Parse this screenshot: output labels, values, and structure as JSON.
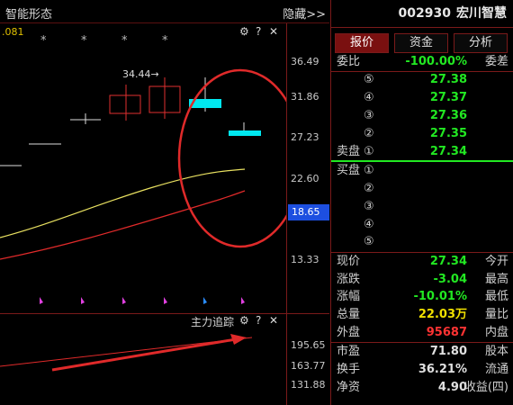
{
  "chart_panel": {
    "title": "智能形态",
    "hide_label": "隐藏>>",
    "top_tag": ".081",
    "tools": {
      "gear": "⚙",
      "help": "?",
      "close": "✕"
    },
    "price_labels": [
      "36.49",
      "31.86",
      "27.23",
      "22.60",
      "13.33"
    ],
    "current_price_label": "18.65",
    "callout": "34.44→",
    "star_glyph": "*"
  },
  "sub_panel": {
    "title": "主力追踪",
    "tools": {
      "gear": "⚙",
      "help": "?",
      "close": "✕"
    },
    "axis_labels": [
      "195.65",
      "163.77",
      "131.88"
    ]
  },
  "quote_panel": {
    "code": "002930",
    "name": "宏川智慧",
    "tabs": [
      "报价",
      "资金",
      "分析"
    ],
    "weibi_label": "委比",
    "weibi_value": "-100.00%",
    "weicha_label": "委差",
    "sell_label": "卖盘",
    "buy_label": "买盘",
    "sell_levels": [
      {
        "n": "⑤",
        "price": "27.38"
      },
      {
        "n": "④",
        "price": "27.37"
      },
      {
        "n": "③",
        "price": "27.36"
      },
      {
        "n": "②",
        "price": "27.35"
      },
      {
        "n": "①",
        "price": "27.34"
      }
    ],
    "buy_levels": [
      "①",
      "②",
      "③",
      "④",
      "⑤"
    ],
    "stats": [
      {
        "l": "现价",
        "v": "27.34",
        "r": "今开",
        "color": "green"
      },
      {
        "l": "涨跌",
        "v": "-3.04",
        "r": "最高",
        "color": "green"
      },
      {
        "l": "涨幅",
        "v": "-10.01%",
        "r": "最低",
        "color": "green"
      },
      {
        "l": "总量",
        "v": "22.03万",
        "r": "量比",
        "color": "yellow"
      },
      {
        "l": "外盘",
        "v": "95687",
        "r": "内盘",
        "color": "red"
      }
    ],
    "fundamentals": [
      {
        "l": "市盈",
        "v": "71.80",
        "r": "股本"
      },
      {
        "l": "换手",
        "v": "36.21%",
        "r": "流通"
      },
      {
        "l": "净资",
        "v": "4.90",
        "r": "收益(四)"
      }
    ],
    "colors": {
      "up": "#ff3333",
      "down": "#22e822",
      "accent": "#f0e000"
    }
  }
}
